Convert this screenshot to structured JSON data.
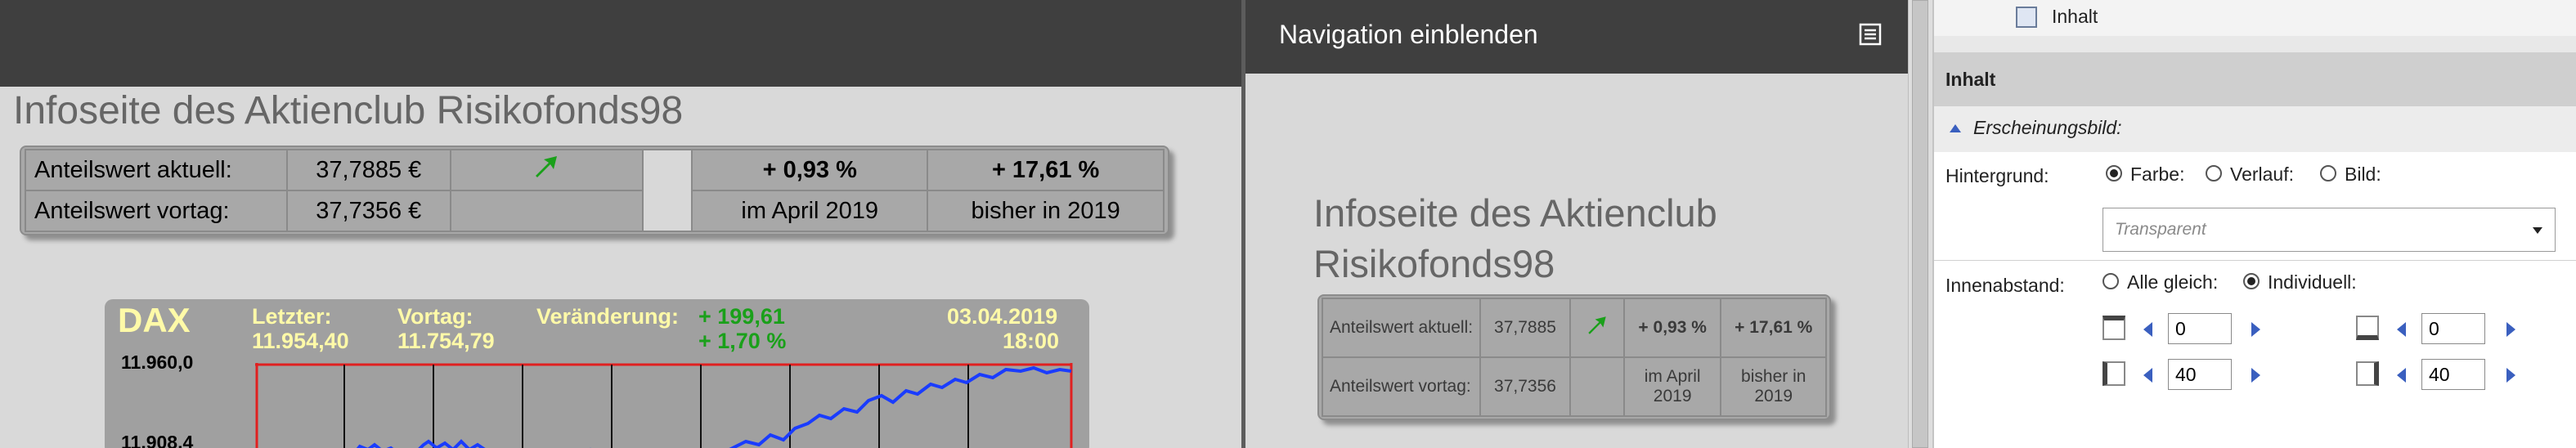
{
  "left": {
    "title": "Infoseite des Aktienclub Risikofonds98",
    "table": {
      "row1": {
        "label": "Anteilswert aktuell:",
        "value": "37,7885 €",
        "change_pct": "+ 0,93 %",
        "change_year": "+ 17,61 %"
      },
      "row2": {
        "label": "Anteilswert vortag:",
        "value": "37,7356 €",
        "period_month": "im April 2019",
        "period_year": "bisher in 2019"
      }
    },
    "chart": {
      "index": "DAX",
      "letzter_label": "Letzter:",
      "letzter_value": "11.954,40",
      "vortag_label": "Vortag:",
      "vortag_value": "11.754,79",
      "veraenderung_label": "Veränderung:",
      "veraenderung_abs": "+ 199,61",
      "veraenderung_pct": "+ 1,70 %",
      "date": "03.04.2019",
      "time": "18:00",
      "y_ticks": [
        "11.960,0",
        "11.908,4"
      ]
    }
  },
  "middle": {
    "nav_label": "Navigation einblenden",
    "title": "Infoseite des Aktienclub Risikofonds98",
    "table": {
      "r1_label": "Anteilswert aktuell:",
      "r1_value": "37,7885",
      "r1_pct": "+ 0,93 %",
      "r1_year": "+ 17,61 %",
      "r2_label": "Anteilswert vortag:",
      "r2_value": "37,7356",
      "r2_month": "im April 2019",
      "r2_year": "bisher in 2019"
    }
  },
  "right": {
    "tree_item": "Inhalt",
    "section_header": "Inhalt",
    "subsection": "Erscheinungsbild:",
    "hintergrund_label": "Hintergrund:",
    "bg_options": {
      "farbe": "Farbe:",
      "verlauf": "Verlauf:",
      "bild": "Bild:"
    },
    "bg_select_value": "Transparent",
    "innenabstand_label": "Innenabstand:",
    "pad_options": {
      "alle": "Alle gleich:",
      "individuell": "Individuell:"
    },
    "padding": {
      "top": "0",
      "bottom": "0",
      "left": "40",
      "right": "40"
    }
  },
  "colors": {
    "green": "#1aa01a",
    "chart_yellow": "#fffaa8",
    "chart_line": "#1a3cff",
    "chart_red": "#e02020"
  }
}
